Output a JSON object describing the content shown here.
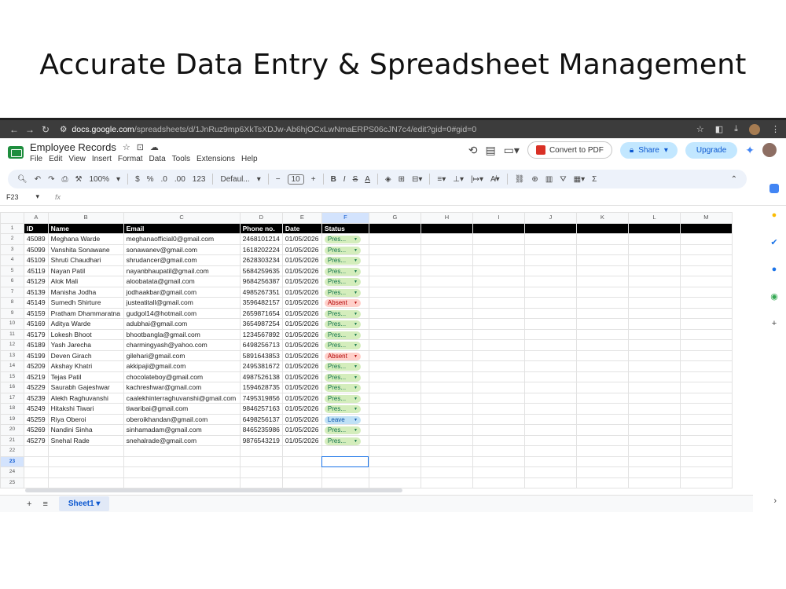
{
  "headline": "Accurate Data Entry & Spreadsheet Management",
  "browser": {
    "url_domain": "docs.google.com",
    "url_rest": "/spreadsheets/d/1JnRuz9mp6XkTsXDJw-Ab6hjOCxLwNmaERPS06cJN7c4/edit?gid=0#gid=0"
  },
  "app": {
    "doc_title": "Employee Records",
    "menu": [
      "File",
      "Edit",
      "View",
      "Insert",
      "Format",
      "Data",
      "Tools",
      "Extensions",
      "Help"
    ],
    "convert_pdf": "Convert to PDF",
    "share": "Share",
    "upgrade": "Upgrade"
  },
  "toolbar": {
    "zoom": "100%",
    "currency": "$",
    "percent": "%",
    "dec_less": ".0",
    "dec_more": ".00",
    "num123": "123",
    "font": "Defaul...",
    "font_size": "10",
    "bold": "B",
    "italic": "I",
    "strike": "S",
    "textcolor": "A",
    "sigma": "Σ"
  },
  "formula_bar": {
    "cell_ref": "F23",
    "fx": "fx"
  },
  "columns": [
    "A",
    "B",
    "C",
    "D",
    "E",
    "F",
    "G",
    "H",
    "I",
    "J",
    "K",
    "L",
    "M"
  ],
  "header_row": [
    "ID",
    "Name",
    "Email",
    "Phone no.",
    "Date",
    "Status"
  ],
  "rows": [
    [
      "45089",
      "Meghana Warde",
      "meghanaofficial0@gmail.com",
      "2468101214",
      "01/05/2026",
      "Pres..."
    ],
    [
      "45099",
      "Vanshita Sonawane",
      "sonawanev@gmail.com",
      "1618202224",
      "01/05/2026",
      "Pres..."
    ],
    [
      "45109",
      "Shruti Chaudhari",
      "shrudancer@gmail.com",
      "2628303234",
      "01/05/2026",
      "Pres..."
    ],
    [
      "45119",
      "Nayan Patil",
      "nayanbhaupatil@gmail.com",
      "5684259635",
      "01/05/2026",
      "Pres..."
    ],
    [
      "45129",
      "Alok Mali",
      "aloobatata@gmail.com",
      "9684256387",
      "01/05/2026",
      "Pres..."
    ],
    [
      "45139",
      "Manisha Jodha",
      "jodhaakbar@gmail.com",
      "4985267351",
      "01/05/2026",
      "Pres..."
    ],
    [
      "45149",
      "Sumedh Shirture",
      "justeatitall@gmail.com",
      "3596482157",
      "01/05/2026",
      "Absent"
    ],
    [
      "45159",
      "Pratham Dhammaratna",
      "gudgol14@hotmail.com",
      "2659871654",
      "01/05/2026",
      "Pres..."
    ],
    [
      "45169",
      "Aditya Warde",
      "adubhai@gmail.com",
      "3654987254",
      "01/05/2026",
      "Pres..."
    ],
    [
      "45179",
      "Lokesh Bhoot",
      "bhootbangla@gmail.com",
      "1234567892",
      "01/05/2026",
      "Pres..."
    ],
    [
      "45189",
      "Yash Jarecha",
      "charmingyash@yahoo.com",
      "6498256713",
      "01/05/2026",
      "Pres..."
    ],
    [
      "45199",
      "Deven Girach",
      "gilehari@gmail.com",
      "5891643853",
      "01/05/2026",
      "Absent"
    ],
    [
      "45209",
      "Akshay Khatri",
      "akkipaji@gmail.com",
      "2495381672",
      "01/05/2026",
      "Pres..."
    ],
    [
      "45219",
      "Tejas Patil",
      "chocolateboy@gmail.com",
      "4987526138",
      "01/05/2026",
      "Pres..."
    ],
    [
      "45229",
      "Saurabh Gajeshwar",
      "kachreshwar@gmail.com",
      "1594628735",
      "01/05/2026",
      "Pres..."
    ],
    [
      "45239",
      "Alekh Raghuvanshi",
      "caalekhinterraghuvanshi@gmail.com",
      "7495319856",
      "01/05/2026",
      "Pres..."
    ],
    [
      "45249",
      "Hitakshi Tiwari",
      "tiwaribai@gmail.com",
      "9846257163",
      "01/05/2026",
      "Pres..."
    ],
    [
      "45259",
      "Riya Oberoi",
      "oberoikhandan@gmail.com",
      "6498256137",
      "01/05/2026",
      "Leave"
    ],
    [
      "45269",
      "Nandini Sinha",
      "sinhamadam@gmail.com",
      "8465235986",
      "01/05/2026",
      "Pres..."
    ],
    [
      "45279",
      "Snehal Rade",
      "snehalrade@gmail.com",
      "9876543219",
      "01/05/2026",
      "Pres..."
    ]
  ],
  "empty_rows": [
    "22",
    "23",
    "24",
    "25"
  ],
  "sheet_tab": "Sheet1",
  "colors": {
    "present": "#d4edbc",
    "absent": "#ffcfc9",
    "leave": "#bfe1f6",
    "accent": "#0b57d0"
  }
}
